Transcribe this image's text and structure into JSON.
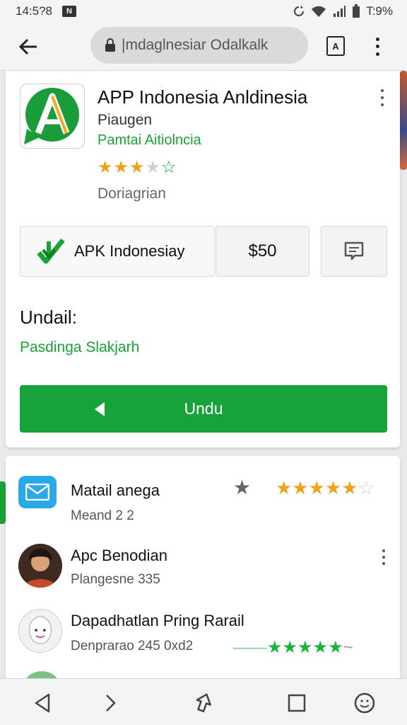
{
  "status_bar": {
    "time": "14:5?8",
    "battery": "T:9%",
    "notification_icon": "n-badge-icon"
  },
  "browser": {
    "url": "|mdaglnesiar Odalkalk",
    "tab_count": "A"
  },
  "app": {
    "title": "APP Indonesia Anldinesia",
    "developer": "Piaugen",
    "publisher": "Pamtai Aitiolncia",
    "rating_filled": 3,
    "rating_total": 5,
    "downloads": "Doriagrian",
    "apk_button_label": "APK Indonesiay",
    "price": "$50",
    "detail_heading": "Undail:",
    "detail_value": "Pasdinga Slakjarh",
    "install_label": "Undu"
  },
  "list": [
    {
      "title": "Matail anega",
      "subtitle": "Meand 2 2",
      "icon": "mail-icon",
      "rating_filled": 5,
      "rating_total": 6
    },
    {
      "title": "Apc Benodian",
      "subtitle": "Plangesne 335",
      "icon": "avatar"
    },
    {
      "title": "Dapadhatlan Pring Rarail",
      "subtitle": "Denprarao 245  0xd2",
      "icon": "avatar-cartoon",
      "rating_filled": 5
    }
  ],
  "colors": {
    "accent_green": "#18a334",
    "star_gold": "#f0a317",
    "mail_blue": "#29a9e8"
  }
}
